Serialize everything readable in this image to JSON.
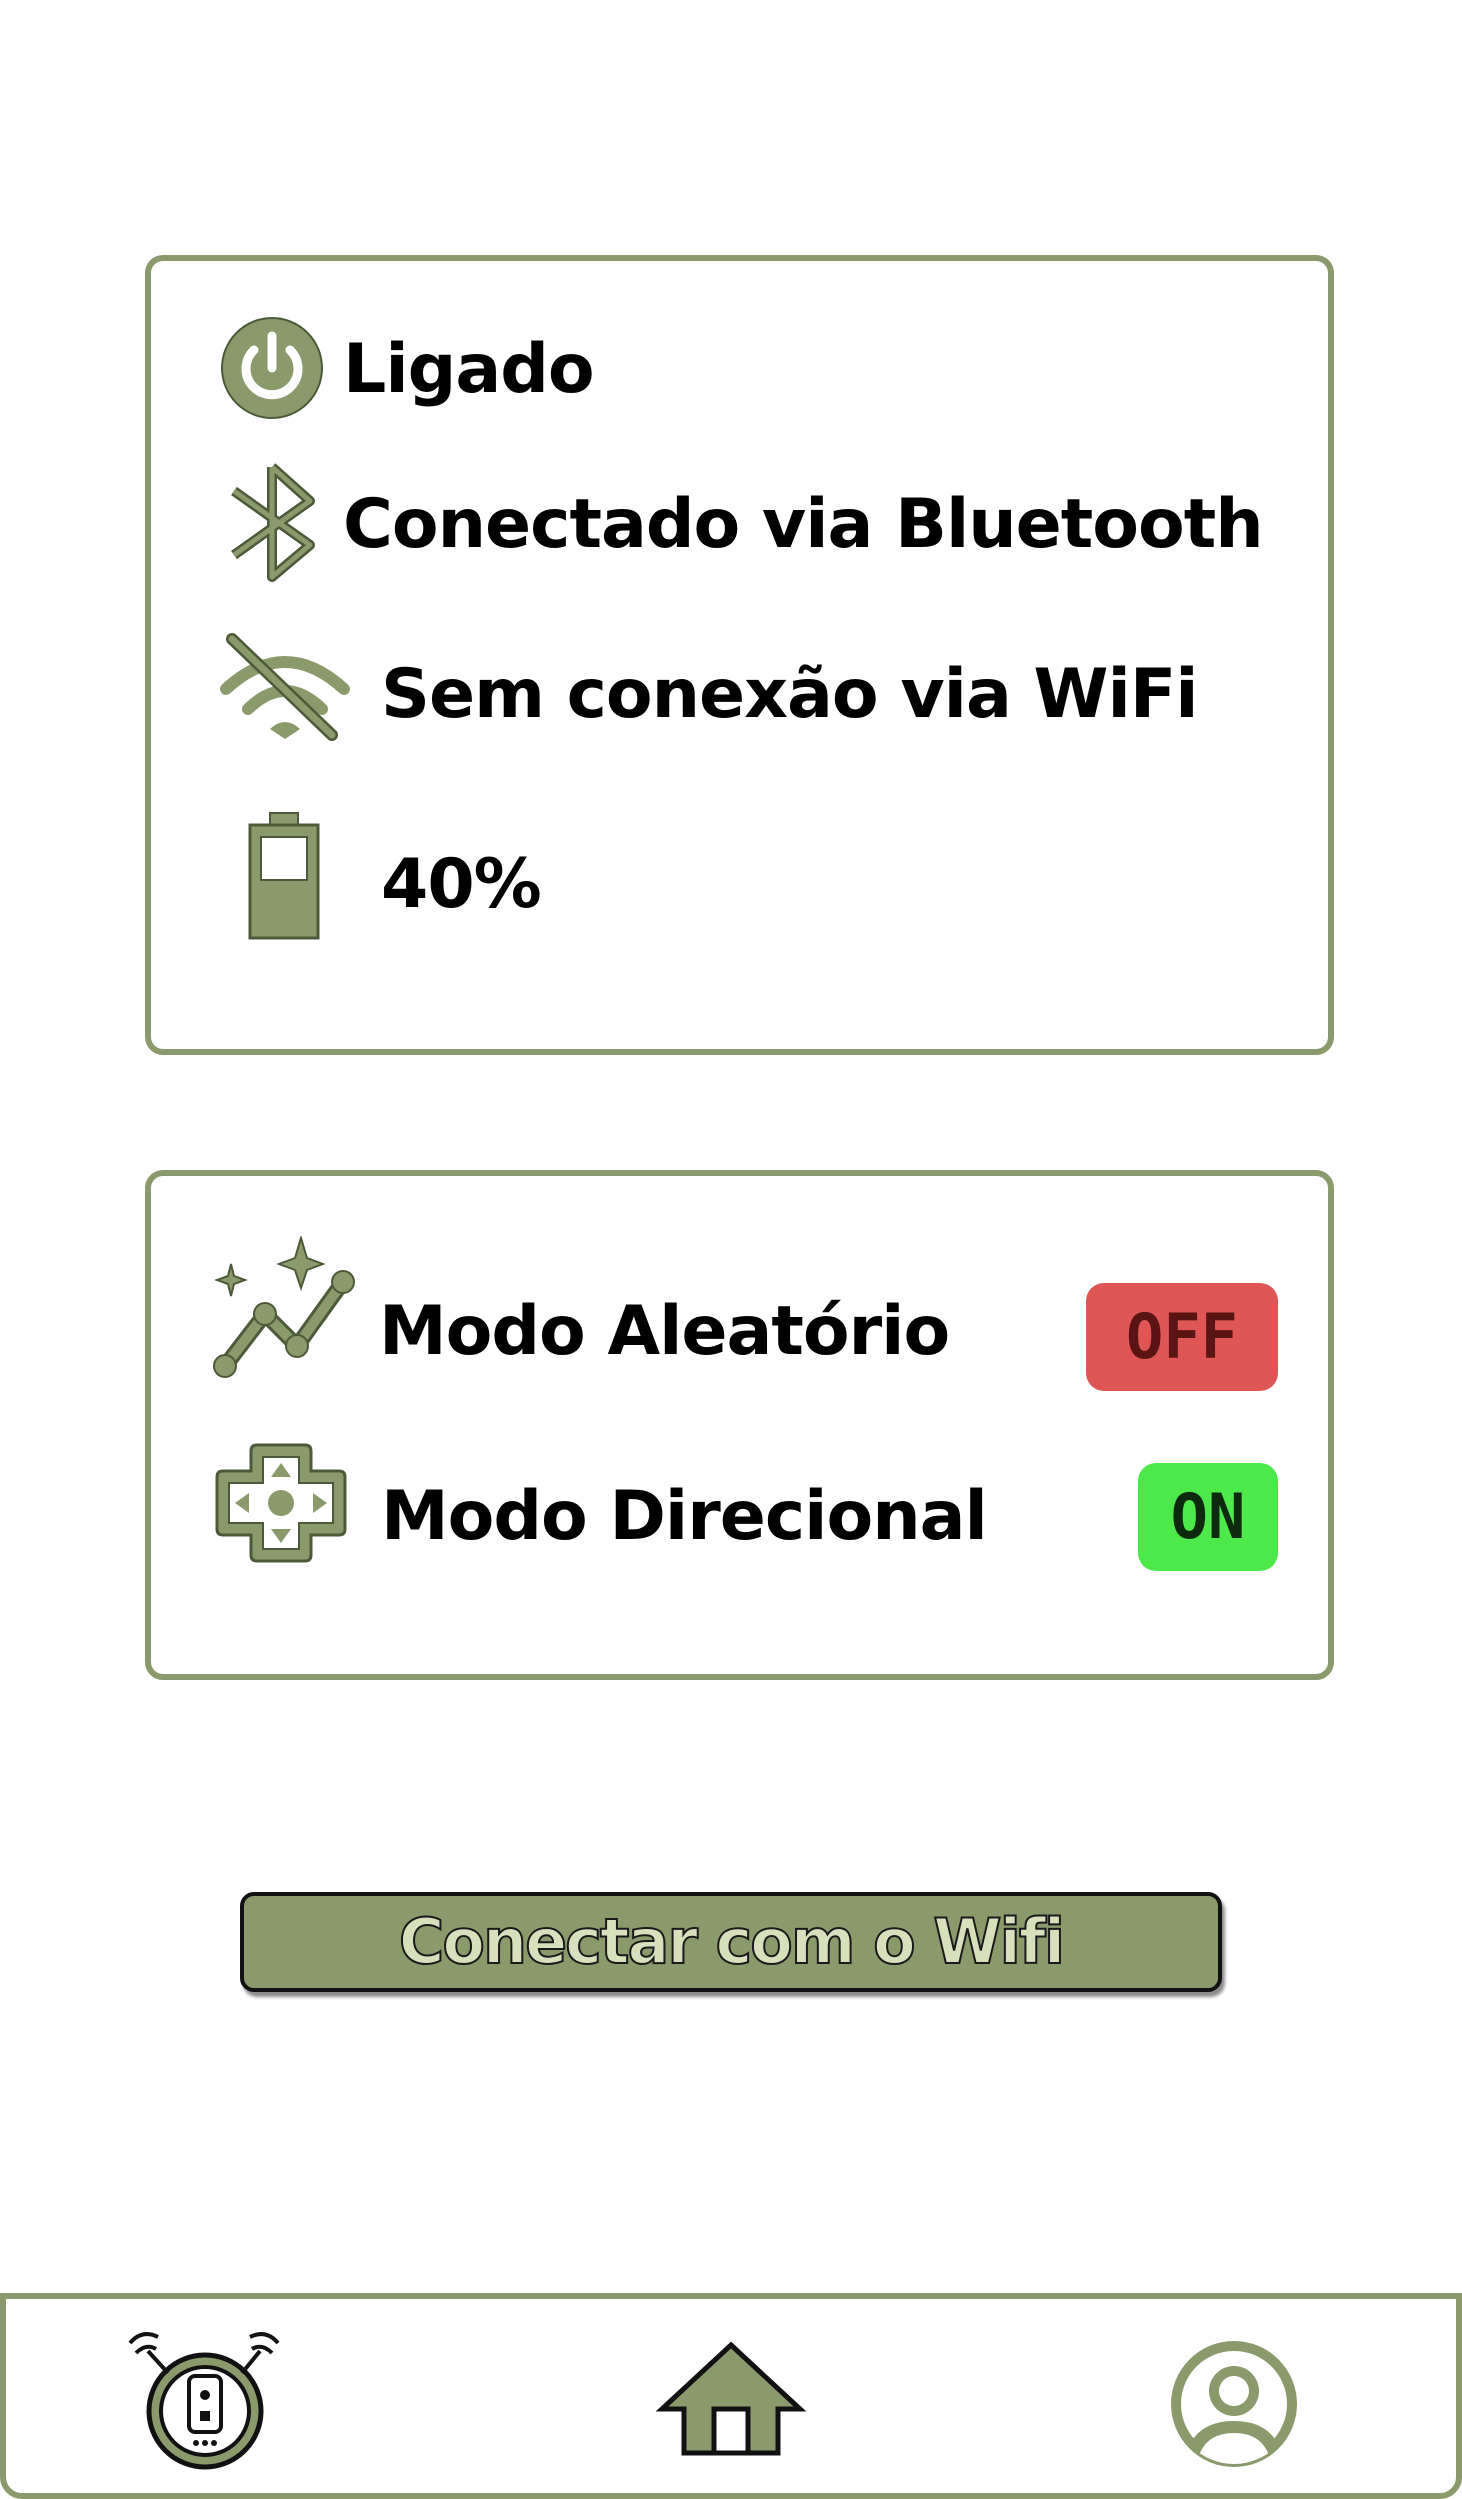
{
  "status": {
    "power_label": "Ligado",
    "bluetooth_label": "Conectado via Bluetooth",
    "wifi_label": "Sem conexão via WiFi",
    "battery_label": "40%",
    "battery_level": 0.4
  },
  "modes": {
    "random_label": "Modo Aleatório",
    "random_state": "OFF",
    "directional_label": "Modo Direcional",
    "directional_state": "ON"
  },
  "actions": {
    "connect_wifi_label": "Conectar com o  Wifi"
  },
  "nav": {
    "items": [
      {
        "icon": "robot-vacuum-icon"
      },
      {
        "icon": "home-icon"
      },
      {
        "icon": "user-icon"
      }
    ]
  },
  "colors": {
    "accent": "#8a9a6c",
    "off": "#e05656",
    "on": "#4de84a"
  }
}
